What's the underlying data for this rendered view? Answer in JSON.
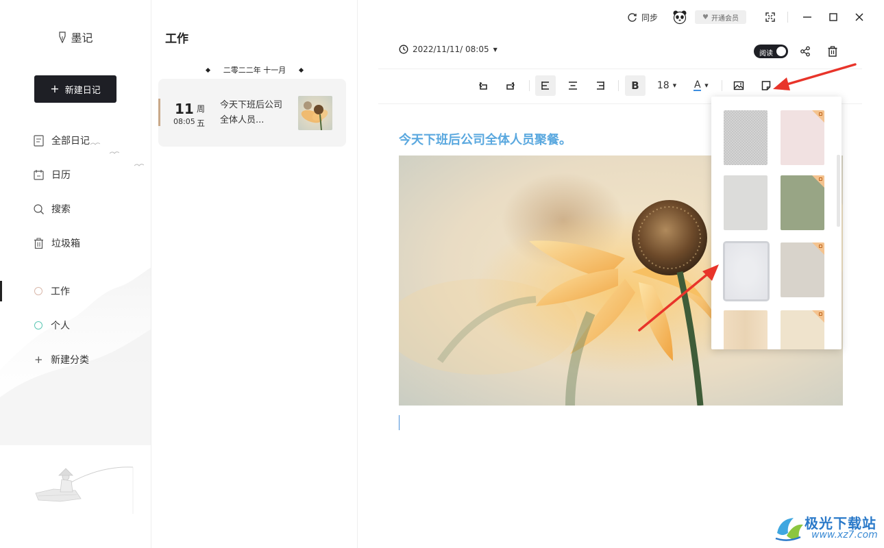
{
  "app": {
    "name": "墨记"
  },
  "sidebar": {
    "new_entry_label": "新建日记",
    "nav": [
      {
        "label": "全部日记",
        "icon": "document-icon"
      },
      {
        "label": "日历",
        "icon": "calendar-icon"
      },
      {
        "label": "搜索",
        "icon": "search-icon"
      },
      {
        "label": "垃圾箱",
        "icon": "trash-icon"
      }
    ],
    "categories": [
      {
        "label": "工作",
        "color": "#d9b8aa"
      },
      {
        "label": "个人",
        "color": "#5cc7b4"
      }
    ],
    "new_category_label": "新建分类"
  },
  "list": {
    "title": "工作",
    "month_label": "二零二二年 十一月",
    "entries": [
      {
        "day": "11",
        "weekday_1": "周",
        "weekday_2": "五",
        "time": "08:05",
        "snippet": "今天下班后公司全体人员..."
      }
    ]
  },
  "topbar": {
    "sync_label": "同步",
    "vip_label": "开通会员"
  },
  "editor": {
    "date_label": "2022/11/11/ 08:05",
    "read_mode_label": "阅读",
    "font_size": "18",
    "font_color_label": "A",
    "bold_label": "B",
    "doc_title": "今天下班后公司全体人员聚餐。"
  },
  "colors": {
    "accent": "#5aa8df",
    "dark_button": "#1e1f25",
    "annotation_arrow": "#e8342a"
  },
  "watermark": {
    "brand": "极光下载站",
    "url": "www.xz7.com"
  }
}
